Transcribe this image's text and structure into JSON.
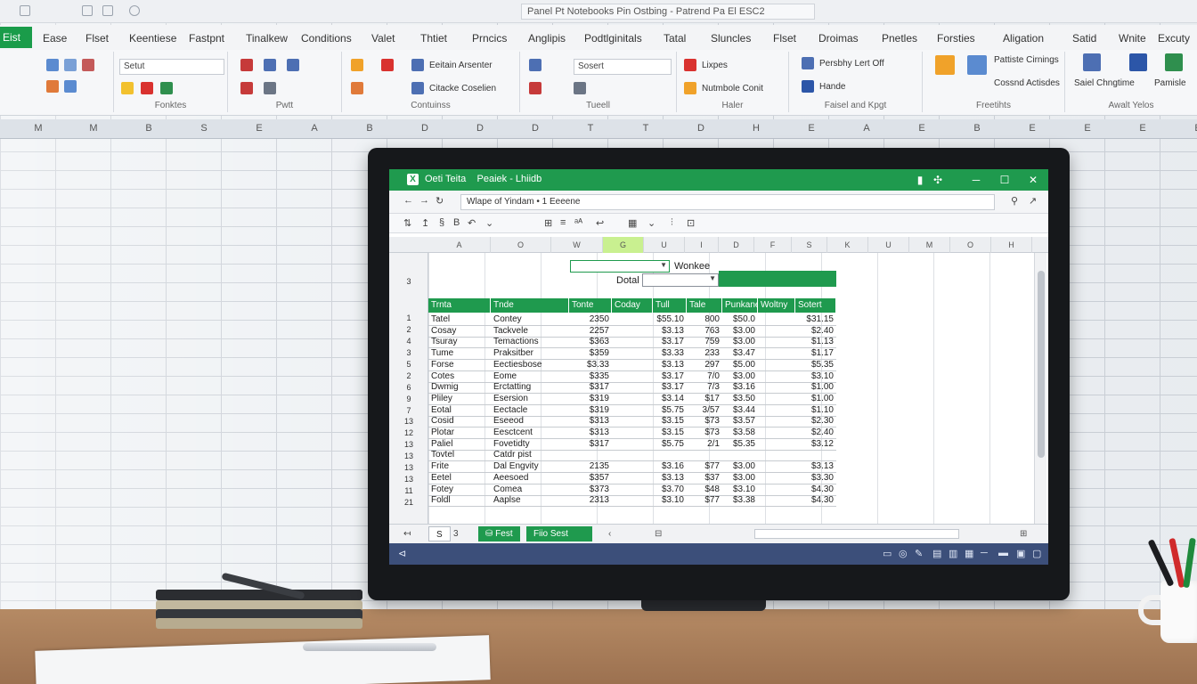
{
  "background_app": {
    "title": "Panel Pt Notebooks Pin Ostbing - Patrend Pa El ESC2",
    "file_tab": "Eist",
    "tabs": [
      "Ease",
      "Flset",
      "Keentiese",
      "Fastpnt",
      "Tinalkew",
      "Conditions",
      "Valet",
      "Thtiet",
      "Prncics",
      "Anglipis",
      "Podtlginitals",
      "Tatal",
      "Sluncles",
      "Flset",
      "Droimas",
      "Pnetles",
      "Forsties",
      "Aligation",
      "Satid",
      "Wnite",
      "Excuty"
    ],
    "ribbon_groups": [
      "Fonktes",
      "Pwtt",
      "Contuinss",
      "Tueell",
      "Haler",
      "Faisel and Kpgt",
      "Freetihts",
      "Awalt Yelos"
    ],
    "ribbon_texts": {
      "font_box": "Setut",
      "number_box": "Sosert",
      "insert_item": "Eeitain Arsenter",
      "cond_item": "Citacke Coselien",
      "style_item": "Lixpes",
      "format_item": "Nutmbole Conit",
      "editing_item1": "Persbhy Lert Off",
      "editing_item2": "Hande",
      "analyze_item1": "Pattiste Cirnings",
      "analyze_item2": "Cossnd Actisdes",
      "ideas_label": "Saiel Chngtime",
      "ideas_label2": "Pamisle"
    },
    "column_headers": [
      "M",
      "M",
      "B",
      "S",
      "E",
      "A",
      "B",
      "D",
      "D",
      "D",
      "T",
      "T",
      "D",
      "H",
      "E",
      "A",
      "E",
      "B",
      "E",
      "E",
      "E",
      "E"
    ]
  },
  "excel": {
    "title": "Oeti Teita",
    "subtitle": "Peaiek - Lhiidb",
    "formula_bar": "Wlape of Yindam • 1 Eeeene",
    "accent": "#1f9a4e",
    "column_headers": [
      "A",
      "O",
      "W",
      "G",
      "U",
      "I",
      "D",
      "F",
      "S",
      "K",
      "U",
      "M",
      "O",
      "H",
      "E"
    ],
    "row_numbers": [
      "3",
      "1",
      "2",
      "4",
      "3",
      "5",
      "2",
      "6",
      "9",
      "7",
      "13",
      "12",
      "13",
      "13",
      "13",
      "13",
      "11",
      "21"
    ],
    "label_wonkee": "Wonkee",
    "label_data": "Dotal",
    "table_headers": [
      "Trnta",
      "Tnde",
      "Tonte",
      "Coday",
      "Tull",
      "Tale",
      "Punkane",
      "Woltny",
      "Sotert"
    ],
    "rows": [
      {
        "c1": "Tatel",
        "c2": "Contey",
        "c3": "2350",
        "c4": "",
        "c5": "$55.10",
        "c6": "800",
        "c7": "$50.0",
        "c8": "",
        "c9": "$31.15"
      },
      {
        "c1": "Cosay",
        "c2": "Tackvele",
        "c3": "2257",
        "c4": "",
        "c5": "$3.13",
        "c6": "763",
        "c7": "$3.00",
        "c8": "",
        "c9": "$2.40"
      },
      {
        "c1": "Tsuray",
        "c2": "Temactions",
        "c3": "$363",
        "c4": "",
        "c5": "$3.17",
        "c6": "759",
        "c7": "$3.00",
        "c8": "",
        "c9": "$1.13"
      },
      {
        "c1": "Tume",
        "c2": "Praksitber",
        "c3": "$359",
        "c4": "",
        "c5": "$3.33",
        "c6": "233",
        "c7": "$3.47",
        "c8": "",
        "c9": "$1.17"
      },
      {
        "c1": "Forse",
        "c2": "Eectiesbose",
        "c3": "$3.33",
        "c4": "",
        "c5": "$3.13",
        "c6": "297",
        "c7": "$5.00",
        "c8": "",
        "c9": "$5.35"
      },
      {
        "c1": "Cotes",
        "c2": "Eome",
        "c3": "$335",
        "c4": "",
        "c5": "$3.17",
        "c6": "7/0",
        "c7": "$3.00",
        "c8": "",
        "c9": "$3.10"
      },
      {
        "c1": "Dwmig",
        "c2": "Erctatting",
        "c3": "$317",
        "c4": "",
        "c5": "$3.17",
        "c6": "7/3",
        "c7": "$3.16",
        "c8": "",
        "c9": "$1.00"
      },
      {
        "c1": "Pliley",
        "c2": "Esersion",
        "c3": "$319",
        "c4": "",
        "c5": "$3.14",
        "c6": "$17",
        "c7": "$3.50",
        "c8": "",
        "c9": "$1.00"
      },
      {
        "c1": "Eotal",
        "c2": "Eectacle",
        "c3": "$319",
        "c4": "",
        "c5": "$5.75",
        "c6": "3/57",
        "c7": "$3.44",
        "c8": "",
        "c9": "$1.10"
      },
      {
        "c1": "Cosid",
        "c2": "Eseeod",
        "c3": "$313",
        "c4": "",
        "c5": "$3.15",
        "c6": "$73",
        "c7": "$3.57",
        "c8": "",
        "c9": "$2.30"
      },
      {
        "c1": "Plotar",
        "c2": "Eesctcent",
        "c3": "$313",
        "c4": "",
        "c5": "$3.15",
        "c6": "$73",
        "c7": "$3.58",
        "c8": "",
        "c9": "$2.40"
      },
      {
        "c1": "Paliel",
        "c2": "Fovetidty",
        "c3": "$317",
        "c4": "",
        "c5": "$5.75",
        "c6": "2/1",
        "c7": "$5.35",
        "c8": "",
        "c9": "$3.12"
      },
      {
        "c1": "Tovtel",
        "c2": "Catdr pist",
        "c3": "",
        "c4": "",
        "c5": "",
        "c6": "",
        "c7": "",
        "c8": "",
        "c9": ""
      },
      {
        "c1": "Frite",
        "c2": "Dal Engvity",
        "c3": "2135",
        "c4": "",
        "c5": "$3.16",
        "c6": "$77",
        "c7": "$3.00",
        "c8": "",
        "c9": "$3.13"
      },
      {
        "c1": "Eetel",
        "c2": "Aeesoed",
        "c3": "$357",
        "c4": "",
        "c5": "$3.13",
        "c6": "$37",
        "c7": "$3.00",
        "c8": "",
        "c9": "$3.30"
      },
      {
        "c1": "Fotey",
        "c2": "Comea",
        "c3": "$373",
        "c4": "",
        "c5": "$3.70",
        "c6": "$48",
        "c7": "$3.10",
        "c8": "",
        "c9": "$4.30"
      },
      {
        "c1": "Foldl",
        "c2": "Aaplse",
        "c3": "2313",
        "c4": "",
        "c5": "$3.10",
        "c6": "$77",
        "c7": "$3.38",
        "c8": "",
        "c9": "$4.30"
      }
    ],
    "sheet_tabs": [
      "Fest",
      "Fiio Sest"
    ],
    "sheet_count": "S",
    "sheet_num": "3"
  }
}
